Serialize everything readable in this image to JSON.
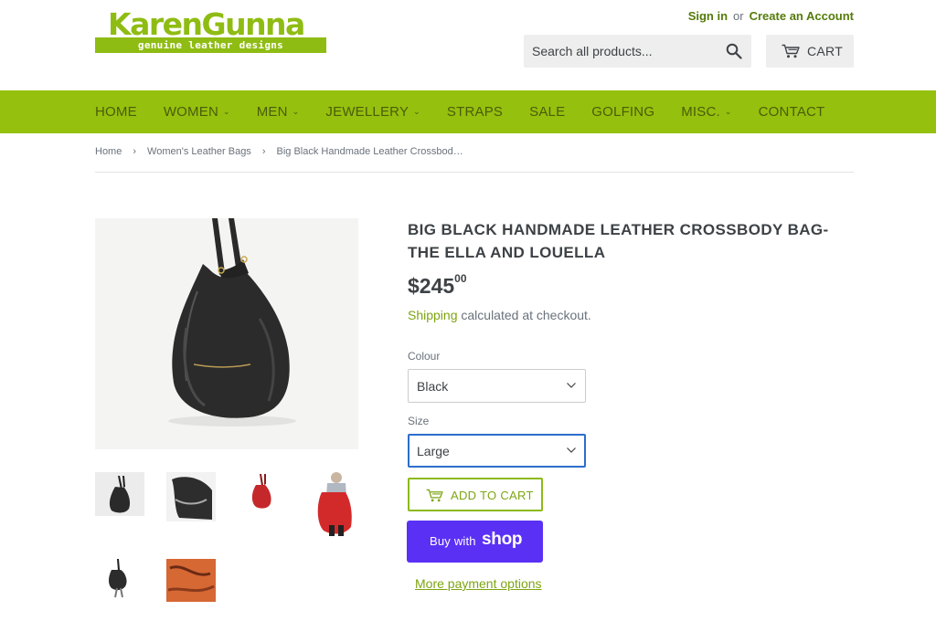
{
  "brand": {
    "name": "KarenGunna",
    "tagline": "genuine leather designs",
    "color": "#8fbc13"
  },
  "account": {
    "sign_in": "Sign in",
    "or": "or",
    "create": "Create an Account"
  },
  "search": {
    "placeholder": "Search all products...",
    "icon": "search-icon"
  },
  "cart": {
    "label": "CART",
    "icon": "cart-icon"
  },
  "nav": {
    "color": "#95c00e",
    "items": [
      {
        "label": "HOME",
        "dropdown": false
      },
      {
        "label": "WOMEN",
        "dropdown": true
      },
      {
        "label": "MEN",
        "dropdown": true
      },
      {
        "label": "JEWELLERY",
        "dropdown": true
      },
      {
        "label": "STRAPS",
        "dropdown": false
      },
      {
        "label": "SALE",
        "dropdown": false
      },
      {
        "label": "GOLFING",
        "dropdown": false
      },
      {
        "label": "MISC.",
        "dropdown": true
      },
      {
        "label": "CONTACT",
        "dropdown": false
      }
    ]
  },
  "breadcrumb": {
    "items": [
      "Home",
      "Women's Leather Bags",
      "Big Black Handmade Leather Crossbod…"
    ],
    "separator": "›"
  },
  "product": {
    "title": "BIG BLACK HANDMADE LEATHER CROSSBODY BAG-THE ELLA AND LOUELLA",
    "price_main": "$245",
    "price_cents": "00",
    "shipping_link": "Shipping",
    "shipping_text": " calculated at checkout.",
    "colour_label": "Colour",
    "colour_value": "Black",
    "size_label": "Size",
    "size_value": "Large",
    "add_to_cart": "ADD TO CART",
    "buy_with": "Buy with",
    "shop_brand": "shop",
    "more_payment": "More payment options",
    "shop_color": "#5a31f4"
  },
  "gallery": {
    "thumbnails": [
      "black-bag-front",
      "black-bag-closeup",
      "red-bag",
      "red-bag-worn",
      "black-bag-small",
      "orange-leather-strap"
    ]
  }
}
